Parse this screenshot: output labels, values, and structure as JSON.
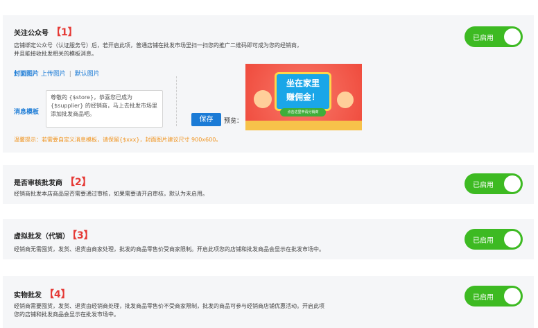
{
  "sections": [
    {
      "title": "关注公众号",
      "num": "【1】",
      "desc_lines": [
        "店铺绑定公众号（认证服务号）后，若开启此项，普通店铺在批发市场里扫一扫您的推广二维码即可成为您的经销商，",
        "并且能接收批发相关的模板消息。"
      ],
      "toggle": "已启用"
    },
    {
      "title": "是否审核批发商",
      "num": "【2】",
      "desc_lines": [
        "经销商批发本店商品是否需要通过审核，如果需要请开启审核，默认为未启用。"
      ],
      "toggle": "已启用"
    },
    {
      "title": "虚拟批发（代销）",
      "num": "【3】",
      "desc_lines": [
        "经销商无需囤货，发货、退货由商家处理，批发的商品零售价受商家限制。开启此项您的店铺和批发商品会显示在批发市场中。"
      ],
      "toggle": "已启用"
    },
    {
      "title": "实物批发",
      "num": "【4】",
      "desc_lines": [
        "经销商需要囤货，发货、退货由经销商处理，批发商品零售价不受商家限制，批发的商品可参与经销商店铺优惠活动。开启此项",
        "您的店铺和批发商品会显示在批发市场中。"
      ],
      "toggle": "已启用"
    }
  ],
  "cover": {
    "label": "封面图片",
    "upload": "上传图片",
    "sep": "|",
    "default": "默认图片",
    "image_text_1": "坐在家里",
    "image_text_2": "赚佣金！",
    "image_strip": "点击这里申请分销商"
  },
  "message": {
    "label": "消息模板",
    "value": "尊敬的 {$store}，恭喜您已成为{$supplier} 的经销商，马上去批发市场里添加批发商品吧。"
  },
  "save_label": "保存",
  "preview_label": "预览：",
  "tip": "温馨提示：若需要自定义消息模板，请保留{$xxx}，封面图片建议尺寸 900x600。",
  "colors": {
    "toggle_on": "#3dba22",
    "link": "#1b7bd6",
    "number": "#e53935",
    "tip": "#f0931d",
    "card_bg": "#f5f6f8"
  }
}
